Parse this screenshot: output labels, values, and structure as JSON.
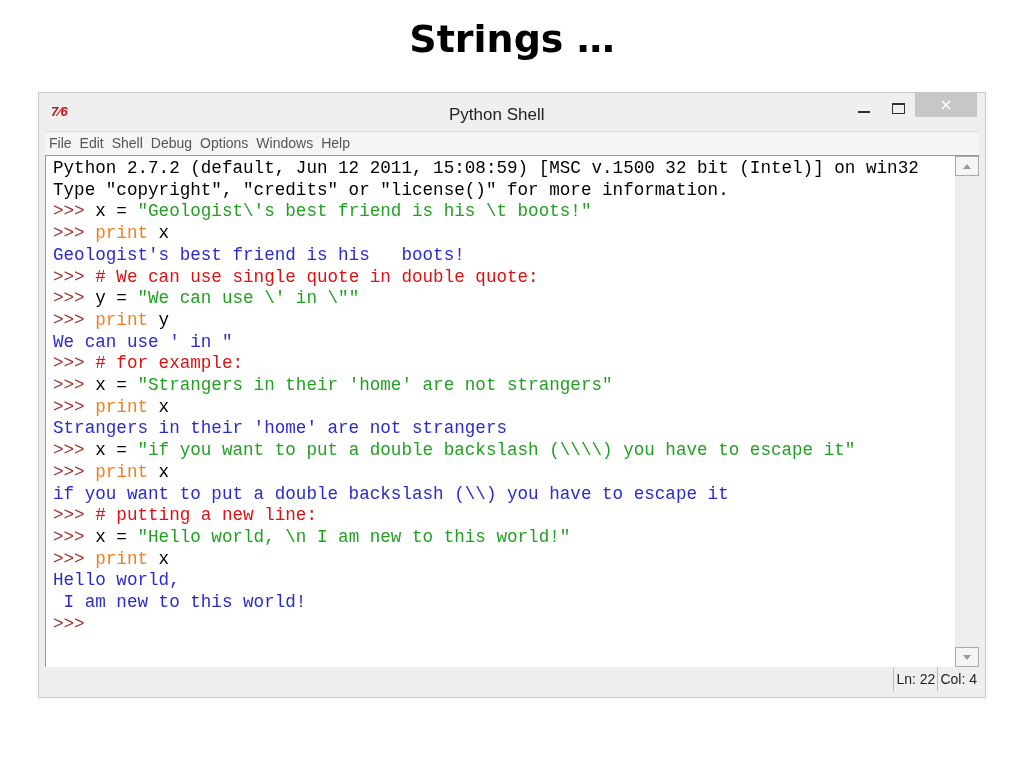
{
  "slide_title": "Strings …",
  "window": {
    "icon_text": "7⁄6",
    "title": "Python Shell"
  },
  "menu": [
    "File",
    "Edit",
    "Shell",
    "Debug",
    "Options",
    "Windows",
    "Help"
  ],
  "lines": [
    [
      {
        "kind": "plain",
        "text": "Python 2.7.2 (default, Jun 12 2011, 15:08:59) [MSC v.1500 32 bit (Intel)] on win32"
      }
    ],
    [
      {
        "kind": "plain",
        "text": "Type \"copyright\", \"credits\" or \"license()\" for more information."
      }
    ],
    [
      {
        "kind": "prompt",
        "text": ">>> "
      },
      {
        "kind": "plain",
        "text": "x = "
      },
      {
        "kind": "string",
        "text": "\"Geologist\\'s best friend is his \\t boots!\""
      }
    ],
    [
      {
        "kind": "prompt",
        "text": ">>> "
      },
      {
        "kind": "keyword",
        "text": "print"
      },
      {
        "kind": "plain",
        "text": " x"
      }
    ],
    [
      {
        "kind": "output",
        "text": "Geologist's best friend is his   boots!"
      }
    ],
    [
      {
        "kind": "prompt",
        "text": ">>> "
      },
      {
        "kind": "comment",
        "text": "# We can use single quote in double quote:"
      }
    ],
    [
      {
        "kind": "prompt",
        "text": ">>> "
      },
      {
        "kind": "plain",
        "text": "y = "
      },
      {
        "kind": "string",
        "text": "\"We can use \\' in \\\"\""
      }
    ],
    [
      {
        "kind": "prompt",
        "text": ">>> "
      },
      {
        "kind": "keyword",
        "text": "print"
      },
      {
        "kind": "plain",
        "text": " y"
      }
    ],
    [
      {
        "kind": "output",
        "text": "We can use ' in \""
      }
    ],
    [
      {
        "kind": "prompt",
        "text": ">>> "
      },
      {
        "kind": "comment",
        "text": "# for example:"
      }
    ],
    [
      {
        "kind": "prompt",
        "text": ">>> "
      },
      {
        "kind": "plain",
        "text": "x = "
      },
      {
        "kind": "string",
        "text": "\"Strangers in their 'home' are not strangers\""
      }
    ],
    [
      {
        "kind": "prompt",
        "text": ">>> "
      },
      {
        "kind": "keyword",
        "text": "print"
      },
      {
        "kind": "plain",
        "text": " x"
      }
    ],
    [
      {
        "kind": "output",
        "text": "Strangers in their 'home' are not strangers"
      }
    ],
    [
      {
        "kind": "prompt",
        "text": ">>> "
      },
      {
        "kind": "plain",
        "text": "x = "
      },
      {
        "kind": "string",
        "text": "\"if you want to put a double backslash (\\\\\\\\) you have to escape it\""
      }
    ],
    [
      {
        "kind": "prompt",
        "text": ">>> "
      },
      {
        "kind": "keyword",
        "text": "print"
      },
      {
        "kind": "plain",
        "text": " x"
      }
    ],
    [
      {
        "kind": "output",
        "text": "if you want to put a double backslash (\\\\) you have to escape it"
      }
    ],
    [
      {
        "kind": "prompt",
        "text": ">>> "
      },
      {
        "kind": "comment",
        "text": "# putting a new line:"
      }
    ],
    [
      {
        "kind": "prompt",
        "text": ">>> "
      },
      {
        "kind": "plain",
        "text": "x = "
      },
      {
        "kind": "string",
        "text": "\"Hello world, \\n I am new to this world!\""
      }
    ],
    [
      {
        "kind": "prompt",
        "text": ">>> "
      },
      {
        "kind": "keyword",
        "text": "print"
      },
      {
        "kind": "plain",
        "text": " x"
      }
    ],
    [
      {
        "kind": "output",
        "text": "Hello world,"
      }
    ],
    [
      {
        "kind": "output",
        "text": " I am new to this world!"
      }
    ],
    [
      {
        "kind": "prompt",
        "text": ">>>"
      }
    ]
  ],
  "status_bar": {
    "line": "Ln: 22",
    "column": "Col: 4"
  }
}
